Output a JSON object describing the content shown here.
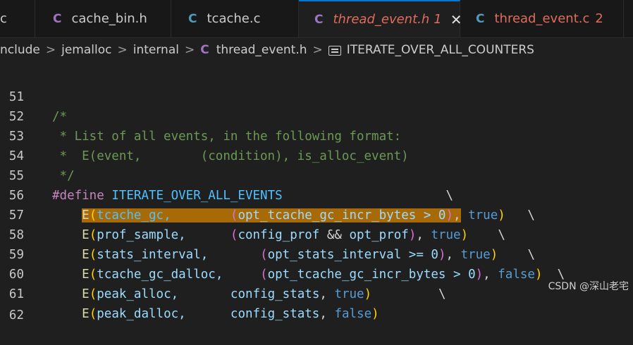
{
  "tabs": [
    {
      "icon": "C",
      "label": "c"
    },
    {
      "icon": "C",
      "label": "cache_bin.h"
    },
    {
      "icon": "C",
      "label": "tcache.c"
    },
    {
      "icon": "C",
      "label": "thread_event.h",
      "badge": "1",
      "close": "✕"
    },
    {
      "icon": "C",
      "label": "thread_event.c",
      "badge": "2"
    }
  ],
  "breadcrumb": {
    "seg0": "nclude",
    "seg1": "jemalloc",
    "seg2": "internal",
    "file_icon": "C",
    "file": "thread_event.h",
    "symbol": "ITERATE_OVER_ALL_COUNTERS",
    "sep": ">"
  },
  "lines": [
    {
      "n": "51"
    },
    {
      "n": "52"
    },
    {
      "n": "53"
    },
    {
      "n": "54"
    },
    {
      "n": "55"
    },
    {
      "n": "56"
    },
    {
      "n": "57"
    },
    {
      "n": "58"
    },
    {
      "n": "59"
    },
    {
      "n": "60"
    },
    {
      "n": "61"
    },
    {
      "n": "62"
    }
  ],
  "code": {
    "l51": "/*",
    "l52": " * List of all events, in the following format:",
    "l53": " *  E(event,        (condition), is_alloc_event)",
    "l54": " */",
    "define": "#define",
    "macro": "ITERATE_OVER_ALL_EVENTS",
    "bs": "\\",
    "E": "E",
    "lp": "(",
    "rp": ")",
    "comma": ",",
    "ev56": "tcache_gc,",
    "c56": "opt_tcache_gc_incr_bytes > 0",
    "ev57": "prof_sample,",
    "c57a": "config_prof",
    "c57op": " && ",
    "c57b": "opt_prof",
    "ev58": "stats_interval,",
    "c58": "opt_stats_interval >= 0",
    "ev59": "tcache_gc_dalloc,",
    "c59": "opt_tcache_gc_incr_bytes > 0",
    "ev60": "peak_alloc,",
    "c60": "config_stats",
    "ev61": "peak_dalloc,",
    "c61": "config_stats",
    "true": "true",
    "false": "false"
  },
  "watermark": "CSDN @深山老宅"
}
